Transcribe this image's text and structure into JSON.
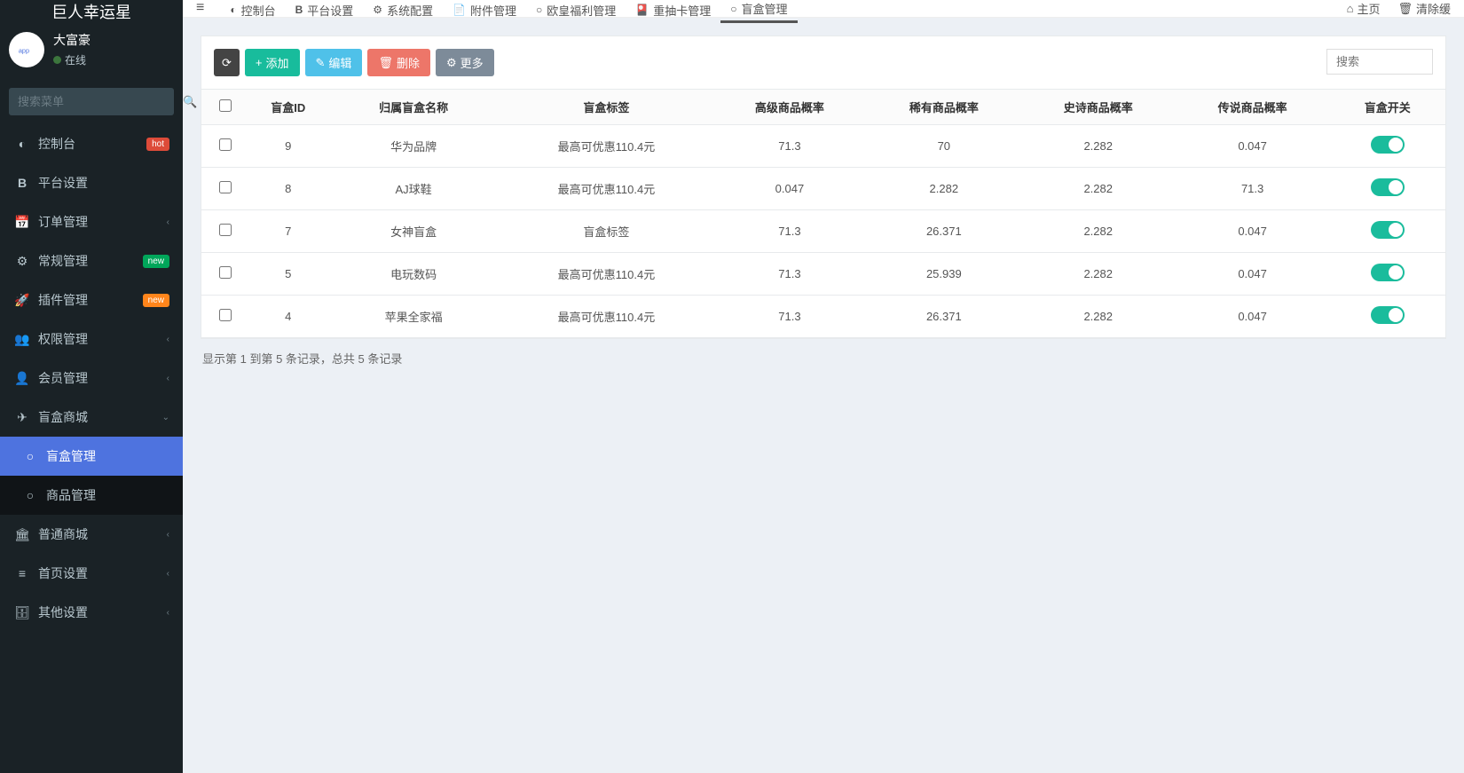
{
  "app_title": "巨人幸运星",
  "user": {
    "name": "大富豪",
    "status": "在线"
  },
  "sidebar_search_placeholder": "搜索菜单",
  "menu": {
    "dashboard": "控制台",
    "platform": "平台设置",
    "order": "订单管理",
    "general": "常规管理",
    "plugin": "插件管理",
    "permission": "权限管理",
    "member": "会员管理",
    "blindbox_mall": "盲盒商城",
    "blindbox_manage": "盲盒管理",
    "product_manage": "商品管理",
    "normal_mall": "普通商城",
    "homepage": "首页设置",
    "other": "其他设置",
    "badge_hot": "hot",
    "badge_new": "new"
  },
  "tabs": {
    "dashboard": "控制台",
    "platform": "平台设置",
    "system": "系统配置",
    "attachment": "附件管理",
    "welfare": "欧皇福利管理",
    "redraw": "重抽卡管理",
    "blindbox": "盲盒管理"
  },
  "top_right": {
    "home": "主页",
    "clear": "清除缓"
  },
  "toolbar": {
    "add": "添加",
    "edit": "编辑",
    "delete": "删除",
    "more": "更多",
    "search_placeholder": "搜索"
  },
  "columns": {
    "id": "盲盒ID",
    "name": "归属盲盒名称",
    "tag": "盲盒标签",
    "high": "高级商品概率",
    "rare": "稀有商品概率",
    "epic": "史诗商品概率",
    "legend": "传说商品概率",
    "switch": "盲盒开关"
  },
  "rows": [
    {
      "id": "9",
      "name": "华为品牌",
      "tag": "最高可优惠110.4元",
      "high": "71.3",
      "rare": "70",
      "epic": "2.282",
      "legend": "0.047"
    },
    {
      "id": "8",
      "name": "AJ球鞋",
      "tag": "最高可优惠110.4元",
      "high": "0.047",
      "rare": "2.282",
      "epic": "2.282",
      "legend": "71.3"
    },
    {
      "id": "7",
      "name": "女神盲盒",
      "tag": "盲盒标签",
      "high": "71.3",
      "rare": "26.371",
      "epic": "2.282",
      "legend": "0.047"
    },
    {
      "id": "5",
      "name": "电玩数码",
      "tag": "最高可优惠110.4元",
      "high": "71.3",
      "rare": "25.939",
      "epic": "2.282",
      "legend": "0.047"
    },
    {
      "id": "4",
      "name": "苹果全家福",
      "tag": "最高可优惠110.4元",
      "high": "71.3",
      "rare": "26.371",
      "epic": "2.282",
      "legend": "0.047"
    }
  ],
  "footer": "显示第 1 到第 5 条记录，总共 5 条记录"
}
